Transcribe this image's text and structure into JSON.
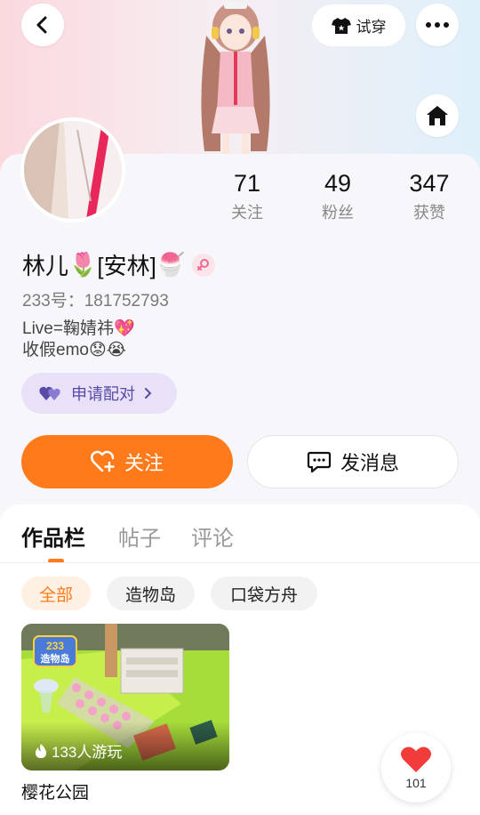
{
  "header": {
    "try_label": "试穿",
    "icons": [
      "back-arrow-icon",
      "shirt-icon",
      "more-icon",
      "home-icon"
    ]
  },
  "stats": [
    {
      "value": "71",
      "label": "关注"
    },
    {
      "value": "49",
      "label": "粉丝"
    },
    {
      "value": "347",
      "label": "获赞"
    }
  ],
  "profile": {
    "name_part1": "林儿",
    "name_emoji1": "🌷",
    "name_part2": "[安林]",
    "name_emoji2": "🍧",
    "gender_icon": "female-icon",
    "uid": "233号：181752793",
    "bio_line1": "Live=鞠婧祎💖",
    "bio_line2": "收假emo😟😭"
  },
  "pair_button": {
    "label": "申请配对"
  },
  "actions": {
    "follow_label": "关注",
    "message_label": "发消息"
  },
  "tabs": [
    {
      "label": "作品栏",
      "active": true
    },
    {
      "label": "帖子",
      "active": false
    },
    {
      "label": "评论",
      "active": false
    }
  ],
  "filters": [
    {
      "label": "全部",
      "active": true
    },
    {
      "label": "造物岛",
      "active": false
    },
    {
      "label": "口袋方舟",
      "active": false
    }
  ],
  "works": [
    {
      "title": "樱花公园",
      "play_count": "133人游玩",
      "logo": "233造物岛"
    }
  ],
  "like": {
    "count": "101"
  },
  "colors": {
    "accent": "#ff7a1a",
    "pair_bg": "#e8e1f7",
    "pair_text": "#5a4aa8",
    "like_red": "#f23b3b"
  }
}
